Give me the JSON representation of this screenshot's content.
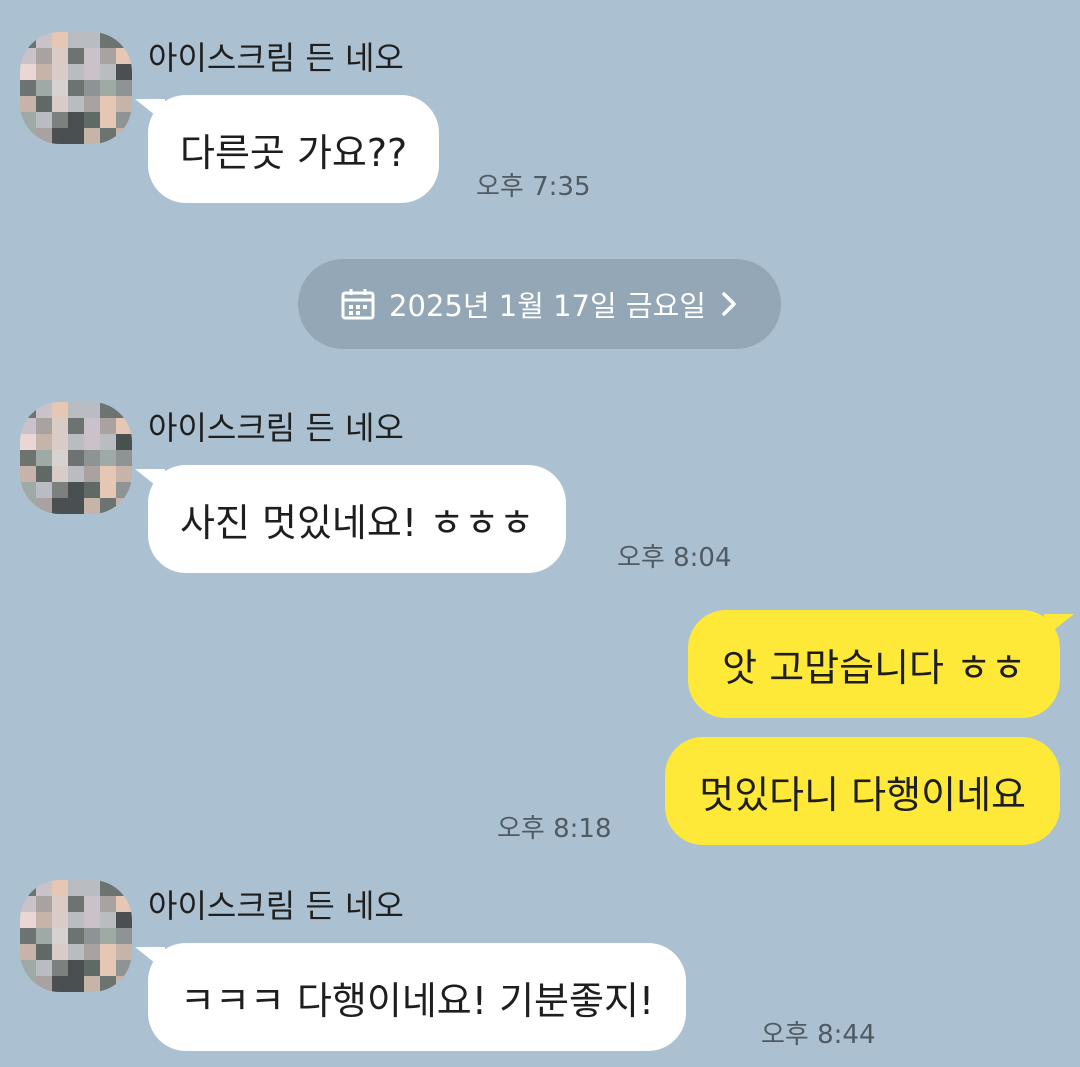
{
  "colors": {
    "background": "#abc1d1",
    "incoming_bubble": "#ffffff",
    "outgoing_bubble": "#fee838",
    "date_chip": "#93a7b6"
  },
  "date_divider": {
    "icon": "calendar-icon",
    "label": "2025년 1월 17일 금요일",
    "chevron": "chevron-right-icon"
  },
  "messages": [
    {
      "sender": "아이스크림 든 네오",
      "text": "다른곳 가요??",
      "time": "오후 7:35"
    },
    {
      "sender": "아이스크림 든 네오",
      "text": "사진 멋있네요! ㅎㅎㅎ",
      "time": "오후 8:04"
    },
    {
      "text": "앗 고맙습니다 ㅎㅎ"
    },
    {
      "text": "멋있다니 다행이네요",
      "time": "오후 8:18"
    },
    {
      "sender": "아이스크림 든 네오",
      "text": "ㅋㅋㅋ 다행이네요!  기분좋지!",
      "time": "오후 8:44"
    }
  ]
}
